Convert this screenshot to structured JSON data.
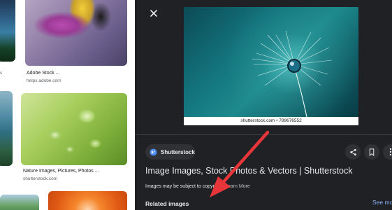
{
  "left_results": [
    {
      "title": "Adobe Stock ...",
      "source": "helpx.adobe.com"
    },
    {
      "title": "Nature Images, Pictures, Photos ...",
      "source": "shutterstock.com"
    }
  ],
  "left_partial_source": "s",
  "preview": {
    "credit": "shutterstock.com • 789676552"
  },
  "source_chip": {
    "label": "Shutterstock"
  },
  "actions": {
    "share": "share-icon",
    "save": "bookmark-icon",
    "more": "more-vert-icon"
  },
  "title": "Image Images, Stock Photos & Vectors | Shutterstock",
  "notice": {
    "text": "Images may be subject to copyright.",
    "link": "Learn More"
  },
  "related": {
    "heading": "Related images",
    "see_more": "See mo"
  },
  "colors": {
    "panel_bg": "#202124",
    "arrow": "#e8353a",
    "link": "#8ab4f8"
  }
}
